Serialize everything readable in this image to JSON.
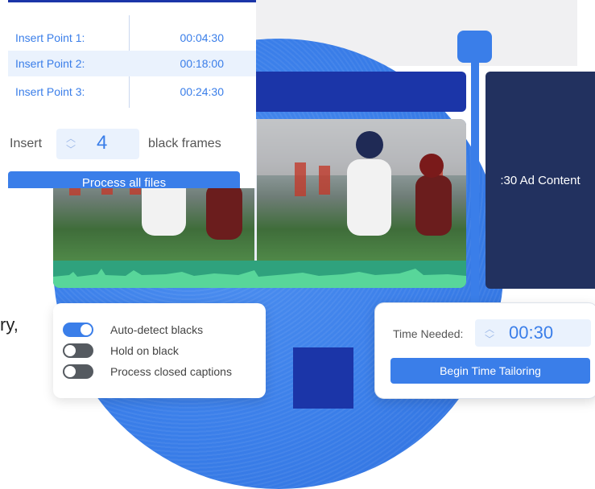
{
  "insert_points": [
    {
      "label": "Insert Point 1:",
      "time": "00:04:30"
    },
    {
      "label": "Insert Point 2:",
      "time": "00:18:00"
    },
    {
      "label": "Insert Point 3:",
      "time": "00:24:30"
    }
  ],
  "insert": {
    "prefix": "Insert",
    "value": "4",
    "suffix": "black frames",
    "process_label": "Process all files"
  },
  "ad": {
    "label": ":30 Ad Content"
  },
  "options": [
    {
      "label": "Auto-detect blacks",
      "state": "on"
    },
    {
      "label": "Hold on black",
      "state": "off"
    },
    {
      "label": "Process closed captions",
      "state": "off"
    }
  ],
  "left_fragment": "ry,",
  "time_tailoring": {
    "label": "Time Needed:",
    "value": "00:30",
    "button_label": "Begin Time Tailoring"
  },
  "colors": {
    "accent": "#3a7ee9",
    "navy": "#1b35a8",
    "panel": "#22315f",
    "waveform": "#2fa27d"
  }
}
